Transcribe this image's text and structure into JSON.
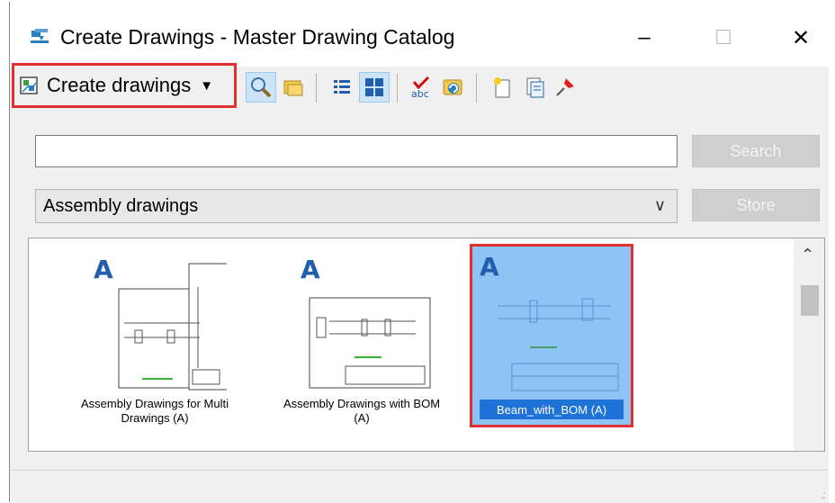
{
  "window": {
    "title": "Create Drawings - Master Drawing Catalog",
    "minimize": "–",
    "maximize": "☐",
    "close": "✕"
  },
  "toolbar": {
    "create_label": "Create drawings",
    "caret": "▼",
    "icons": [
      "search-icon",
      "open-folder-icon",
      "list-view-icon",
      "thumbnail-view-icon",
      "spellcheck-icon",
      "refresh-icon",
      "new-icon",
      "properties-icon",
      "pin-icon"
    ],
    "active_icons": [
      "search-icon",
      "thumbnail-view-icon"
    ]
  },
  "search": {
    "value": "",
    "button": "Search"
  },
  "catalog": {
    "selected": "Assembly drawings",
    "store_button": "Store"
  },
  "items": [
    {
      "caption": "Assembly Drawings for Multi Drawings (A)",
      "letter": "A"
    },
    {
      "caption": "Assembly Drawings with BOM (A)",
      "letter": "A"
    },
    {
      "caption": "Beam_with_BOM (A)",
      "letter": "A",
      "selected": true
    }
  ],
  "colors": {
    "highlight": "#e03030",
    "selection": "#1e72d8",
    "selection_bg": "#8ec3f5"
  }
}
